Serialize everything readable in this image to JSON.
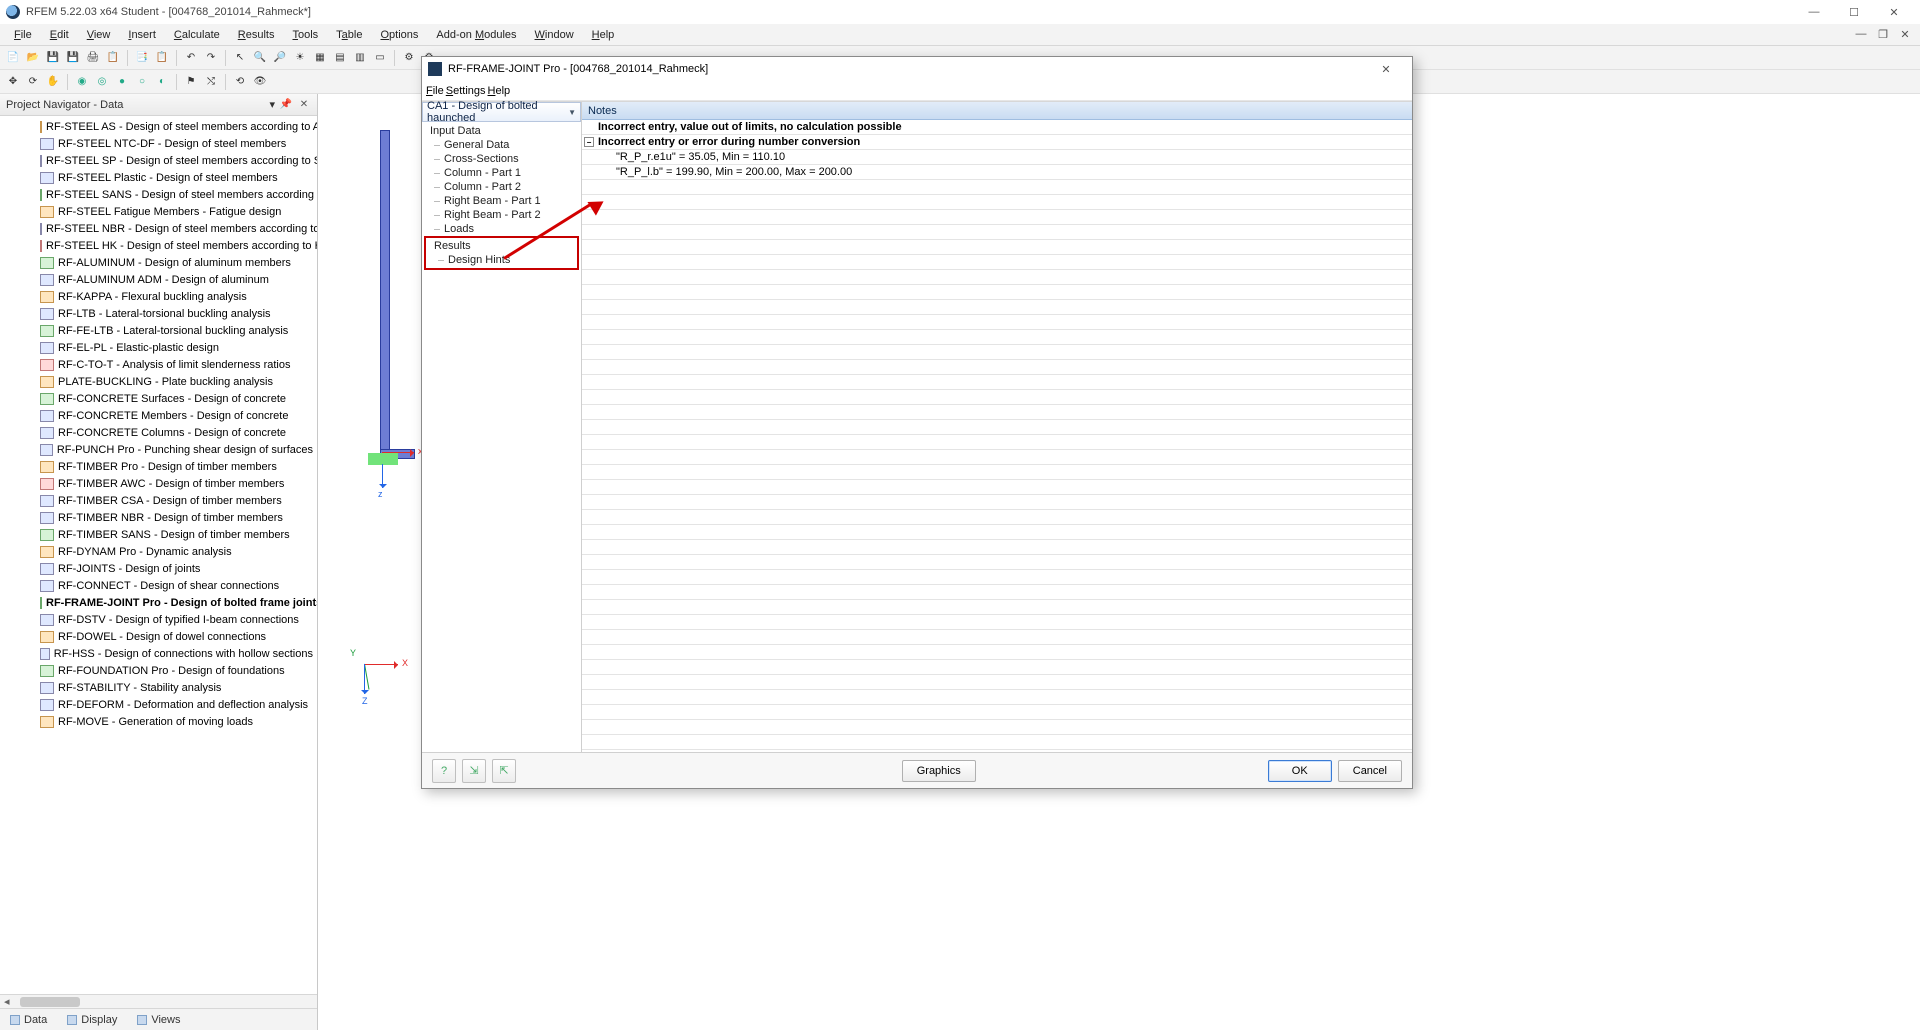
{
  "main_window": {
    "title": "RFEM 5.22.03 x64 Student - [004768_201014_Rahmeck*]",
    "menu": [
      "File",
      "Edit",
      "View",
      "Insert",
      "Calculate",
      "Results",
      "Tools",
      "Table",
      "Options",
      "Add-on Modules",
      "Window",
      "Help"
    ]
  },
  "navigator": {
    "title": "Project Navigator - Data",
    "tabs": [
      "Data",
      "Display",
      "Views"
    ],
    "items": [
      "RF-STEEL AS - Design of steel members according to AS",
      "RF-STEEL NTC-DF - Design of steel members",
      "RF-STEEL SP - Design of steel members according to SP",
      "RF-STEEL Plastic - Design of steel members",
      "RF-STEEL SANS - Design of steel members according to SANS",
      "RF-STEEL Fatigue Members - Fatigue design",
      "RF-STEEL NBR - Design of steel members according to NBR",
      "RF-STEEL HK - Design of steel members according to HK",
      "RF-ALUMINUM - Design of aluminum members",
      "RF-ALUMINUM ADM - Design of aluminum",
      "RF-KAPPA - Flexural buckling analysis",
      "RF-LTB - Lateral-torsional buckling analysis",
      "RF-FE-LTB - Lateral-torsional buckling analysis",
      "RF-EL-PL - Elastic-plastic design",
      "RF-C-TO-T - Analysis of limit slenderness ratios",
      "PLATE-BUCKLING - Plate buckling analysis",
      "RF-CONCRETE Surfaces - Design of concrete",
      "RF-CONCRETE Members - Design of concrete",
      "RF-CONCRETE Columns - Design of concrete",
      "RF-PUNCH Pro - Punching shear design of surfaces",
      "RF-TIMBER Pro - Design of timber members",
      "RF-TIMBER AWC - Design of timber members",
      "RF-TIMBER CSA - Design of timber members",
      "RF-TIMBER NBR - Design of timber members",
      "RF-TIMBER SANS - Design of timber members",
      "RF-DYNAM Pro - Dynamic analysis",
      "RF-JOINTS - Design of joints",
      "RF-CONNECT - Design of shear connections",
      "RF-FRAME-JOINT Pro - Design of bolted frame joints",
      "RF-DSTV - Design of typified I-beam connections",
      "RF-DOWEL - Design of dowel connections",
      "RF-HSS - Design of connections with hollow sections",
      "RF-FOUNDATION Pro - Design of foundations",
      "RF-STABILITY - Stability analysis",
      "RF-DEFORM - Deformation and deflection analysis",
      "RF-MOVE - Generation of moving loads"
    ],
    "bold_index": 28
  },
  "viewport": {
    "axis_x": "x",
    "axis_z": "z",
    "gy": "Y",
    "gx": "X",
    "gz": "Z"
  },
  "dialog": {
    "title": "RF-FRAME-JOINT Pro - [004768_201014_Rahmeck]",
    "menu": [
      "File",
      "Settings",
      "Help"
    ],
    "case": "CA1 - Design of bolted haunched",
    "tree": {
      "input": "Input Data",
      "input_children": [
        "General Data",
        "Cross-Sections",
        "Column - Part 1",
        "Column - Part 2",
        "Right Beam - Part 1",
        "Right Beam - Part 2",
        "Loads"
      ],
      "results": "Results",
      "results_children": [
        "Design Hints"
      ]
    },
    "notes_header": "Notes",
    "notes": [
      {
        "text": "Incorrect entry, value out of limits, no calculation possible",
        "bold": true,
        "indent": 0
      },
      {
        "text": "Incorrect entry or error during number conversion",
        "bold": true,
        "indent": 0,
        "exp": true
      },
      {
        "text": "\"R_P_r.e1u\" = 35.05, Min = 110.10",
        "bold": false,
        "indent": 1
      },
      {
        "text": "\"R_P_l.b\" = 199.90, Min = 200.00, Max = 200.00",
        "bold": false,
        "indent": 1
      }
    ],
    "footer": {
      "graphics": "Graphics",
      "ok": "OK",
      "cancel": "Cancel"
    }
  }
}
